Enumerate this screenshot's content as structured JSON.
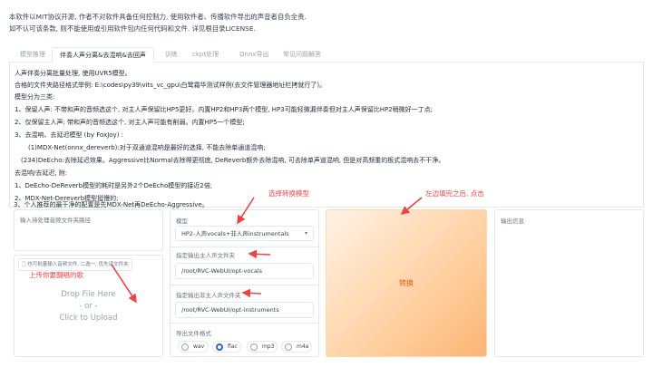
{
  "notice": {
    "line1": "本软件以MIT协议开源, 作者不对软件具备任何控制力, 使用软件者、传播软件导出的声音者自负全责.",
    "line2": "如不认可该条款, 则不能使用或引用软件包内任何代码和文件. 详见根目录LICENSE."
  },
  "tabs": [
    "模型推理",
    "伴奏人声分离&去混响&去回声",
    "训练",
    "ckpt处理",
    "Onnx导出",
    "常见问题解答"
  ],
  "description": [
    "人声伴奏分离批量处理, 使用UVR5模型。",
    "合格的文件夹路径格式举例: E:\\codes\\py39\\vits_vc_gpu\\白鹭霜华测试样例(去文件管理器地址栏拷就行了)。",
    "模型分为三类:",
    "1、保留人声: 不带和声的音频选这个, 对主人声保留比HP5更好。内置HP2和HP3两个模型, HP3可能轻微漏伴奏但对主人声保留比HP2稍微好一丁点;",
    "2、仅保留主人声: 带和声的音频选这个, 对主人声可能有削弱。内置HP5一个模型;",
    "3、去混响、去延迟模型 (by FoxJoy) :",
    "(1)MDX-Net(onnx_dereverb):对于双通道混响是最好的选择, 不能去除单通道混响;",
    "(234)DeEcho:去除延迟效果。Aggressive比Normal去除得更彻底, DeReverb额外去除混响, 可去除单声道混响, 但是对高频重的板式混响去不干净。",
    "去混响/去延迟, 附:",
    "1、DeEcho-DeReverb模型的耗时是另外2个DeEcho模型的接近2倍;",
    "2、MDX-Net-Dereverb模型挺慢的;",
    "3、个人推荐的最干净的配置是先MDX-Net再DeEcho-Aggressive。"
  ],
  "input_dir": {
    "label": "输入待处理音频文件夹路径",
    "value": ""
  },
  "upload": {
    "label": "也可批量输入音频文件, 二选一, 优先读文件夹",
    "drop_line1": "Drop File Here",
    "drop_line2": "- or -",
    "drop_line3": "Click to Upload"
  },
  "model": {
    "label": "模型",
    "selected": "HP2-人声vocals+非人声instrumentals"
  },
  "vocal_dir": {
    "label": "指定输出主人声文件夹",
    "value": "/root/RVC-WebUI/opt-vocals"
  },
  "instr_dir": {
    "label": "指定输出非主人声文件夹",
    "value": "/root/RVC-WebUI/opt-instruments"
  },
  "export_format": {
    "label": "导出文件格式",
    "options": [
      "wav",
      "flac",
      "mp3",
      "m4a"
    ],
    "selected": "flac"
  },
  "convert_button": "转换",
  "output_info": {
    "label": "输出信息"
  },
  "annotations": {
    "select_model": "选择转换模型",
    "after_fill": "左边填完之后, 点击",
    "upload_song": "上传你要翻唱的歌"
  },
  "colors": {
    "annotation": "#ef4444",
    "button_accent": "#ea580c",
    "radio_selected": "#2563eb"
  }
}
